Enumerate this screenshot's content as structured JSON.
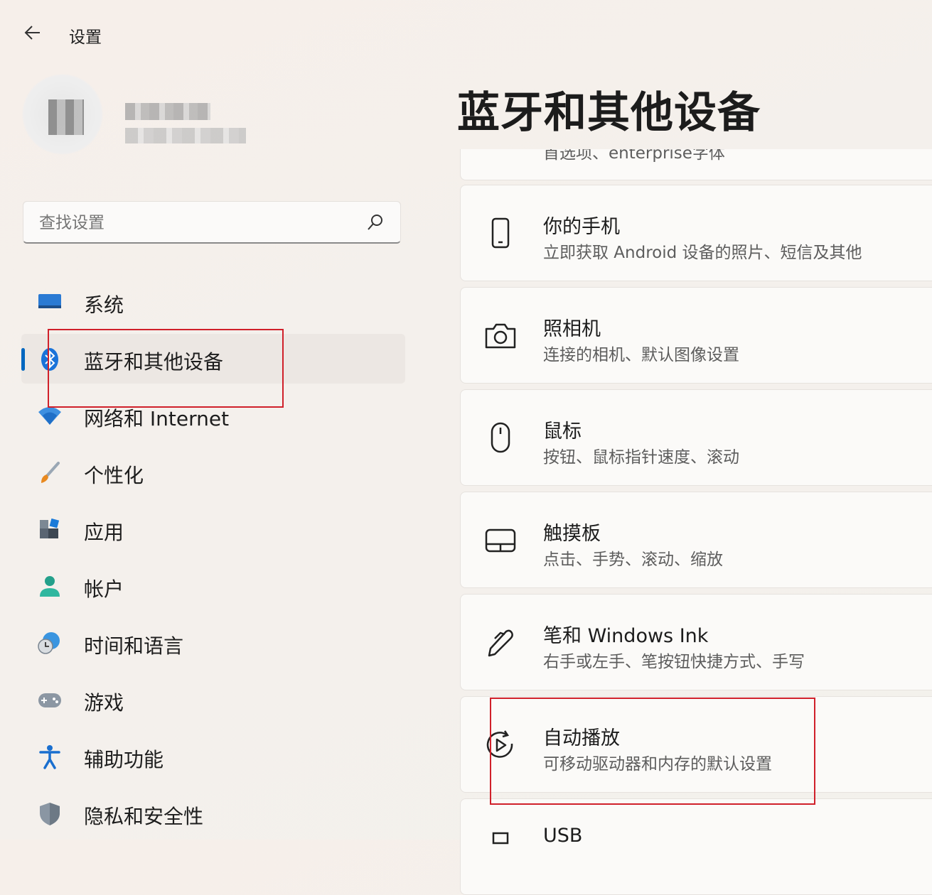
{
  "window": {
    "title": "设置"
  },
  "search": {
    "placeholder": "查找设置"
  },
  "nav": {
    "items": [
      {
        "label": "系统",
        "icon": "system-monitor-icon"
      },
      {
        "label": "蓝牙和其他设备",
        "icon": "bluetooth-icon",
        "active": true
      },
      {
        "label": "网络和 Internet",
        "icon": "wifi-icon"
      },
      {
        "label": "个性化",
        "icon": "paintbrush-icon"
      },
      {
        "label": "应用",
        "icon": "apps-icon"
      },
      {
        "label": "帐户",
        "icon": "account-icon"
      },
      {
        "label": "时间和语言",
        "icon": "time-language-icon"
      },
      {
        "label": "游戏",
        "icon": "gamepad-icon"
      },
      {
        "label": "辅助功能",
        "icon": "accessibility-icon"
      },
      {
        "label": "隐私和安全性",
        "icon": "shield-icon"
      }
    ]
  },
  "main": {
    "title": "蓝牙和其他设备",
    "partial_top_sub": "首选项、enterprise字体",
    "cards": [
      {
        "title": "你的手机",
        "sub": "立即获取 Android 设备的照片、短信及其他",
        "icon": "phone-icon"
      },
      {
        "title": "照相机",
        "sub": "连接的相机、默认图像设置",
        "icon": "camera-icon"
      },
      {
        "title": "鼠标",
        "sub": "按钮、鼠标指针速度、滚动",
        "icon": "mouse-icon"
      },
      {
        "title": "触摸板",
        "sub": "点击、手势、滚动、缩放",
        "icon": "touchpad-icon"
      },
      {
        "title": "笔和 Windows Ink",
        "sub": "右手或左手、笔按钮快捷方式、手写",
        "icon": "pen-icon"
      },
      {
        "title": "自动播放",
        "sub": "可移动驱动器和内存的默认设置",
        "icon": "autoplay-icon"
      },
      {
        "title": "USB",
        "sub": "",
        "icon": "usb-icon"
      }
    ]
  },
  "colors": {
    "accent": "#0067c0",
    "highlight": "#d0202a"
  }
}
